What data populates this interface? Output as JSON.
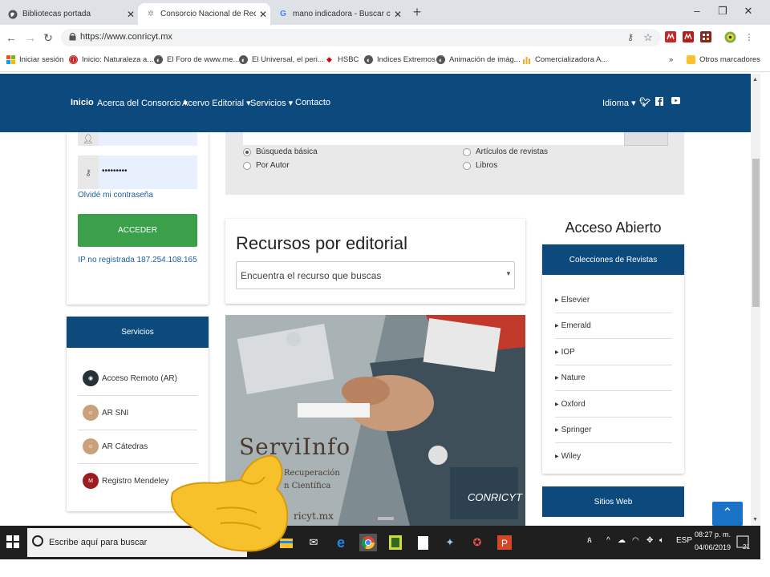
{
  "browser": {
    "tabs": [
      {
        "title": "Bibliotecas portada",
        "icon": "globe-icon"
      },
      {
        "title": "Consorcio Nacional de Recursos",
        "icon": "conricyt-favicon-icon"
      },
      {
        "title": "mano indicadora - Buscar con G",
        "icon": "google-icon"
      }
    ],
    "new_tab": "+",
    "window": {
      "minimize": "–",
      "maximize": "❐",
      "close": "✕"
    },
    "url": "https://www.conricyt.mx",
    "bookmarks": [
      {
        "label": "Iniciar sesión",
        "icon": "microsoft-icon"
      },
      {
        "label": "Inicio: Naturaleza a...",
        "icon": "red-circle-icon"
      },
      {
        "label": "El Foro de www.me...",
        "icon": "globe-icon"
      },
      {
        "label": "El Universal, el peri...",
        "icon": "globe-icon"
      },
      {
        "label": "HSBC",
        "icon": "hsbc-icon"
      },
      {
        "label": "Indices Extremos",
        "icon": "globe-icon"
      },
      {
        "label": "Animación de imág...",
        "icon": "globe-icon"
      },
      {
        "label": "Comercializadora A...",
        "icon": "chart-icon"
      }
    ],
    "bookmarks_more": "»",
    "other_bookmarks": "Otros marcadores"
  },
  "site": {
    "nav": [
      "Inicio",
      "Acerca del Consorcio ▾",
      "Acervo Editorial ▾",
      "Servicios ▾",
      "Contacto"
    ],
    "language": "Idioma ▾",
    "social": [
      "twitter-icon",
      "facebook-icon",
      "youtube-icon"
    ]
  },
  "login": {
    "password_value": "•••••••••",
    "forgot": "Olvidé mi contraseña",
    "access_button": "ACCEDER",
    "ip_note": "IP no registrada 187.254.108.165"
  },
  "search": {
    "options_left": [
      "Búsqueda básica",
      "Por Autor"
    ],
    "options_right": [
      "Artículos de revistas",
      "Libros"
    ]
  },
  "recursos": {
    "title": "Recursos por editorial",
    "select_value": "Encuentra el recurso que buscas"
  },
  "banner": {
    "title": "ServiInfo",
    "line1": "Recuperación",
    "line2": "n Científica",
    "site": "ricyt.mx",
    "logo": "CONRICYT"
  },
  "servicios": {
    "heading": "Servicios",
    "items": [
      "Acceso Remoto (AR)",
      "AR SNI",
      "AR Cátedras",
      "Registro Mendeley"
    ]
  },
  "acceso_abierto": {
    "title": "Acceso Abierto",
    "collections_heading": "Colecciones de Revistas",
    "publishers": [
      "Elsevier",
      "Emerald",
      "IOP",
      "Nature",
      "Oxford",
      "Springer",
      "Wiley"
    ],
    "sites_heading": "Sitios Web"
  },
  "taskbar": {
    "search_placeholder": "Escribe aquí para buscar",
    "language": "ESP",
    "time": "08:27 p. m.",
    "date": "04/06/2019",
    "notifications": "21"
  },
  "colors": {
    "nav_blue": "#0c4a7e",
    "green": "#3aa04a",
    "link": "#1a5f9e"
  }
}
